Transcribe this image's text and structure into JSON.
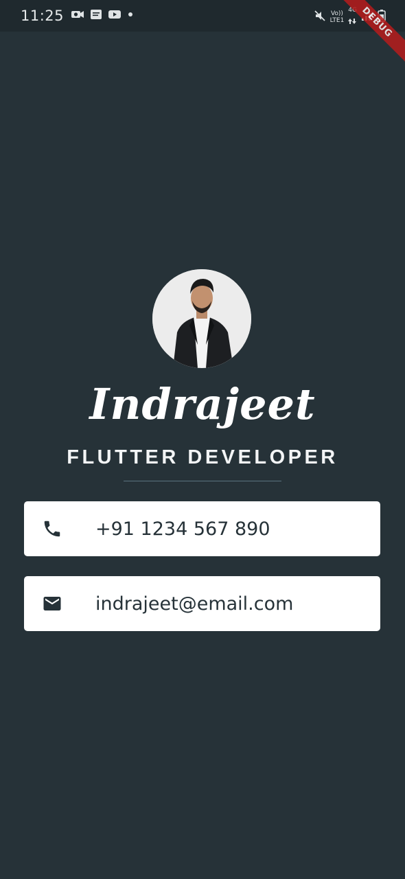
{
  "status_bar": {
    "time": "11:25",
    "left_icons": [
      "camera-icon",
      "message-icon",
      "youtube-icon",
      "dot-icon"
    ],
    "network_top": "Vo))",
    "network_bottom": "LTE1",
    "network_type": "4G",
    "right_icons": [
      "mute-icon",
      "signal-icon",
      "battery-icon"
    ]
  },
  "debug_banner": "DEBUG",
  "profile": {
    "name": "Indrajeet",
    "role": "FLUTTER DEVELOPER"
  },
  "contacts": [
    {
      "icon": "phone-icon",
      "text": "+91 1234 567 890"
    },
    {
      "icon": "mail-icon",
      "text": "indrajeet@email.com"
    }
  ],
  "colors": {
    "background": "#263238",
    "card": "#ffffff",
    "icon": "#263238"
  }
}
